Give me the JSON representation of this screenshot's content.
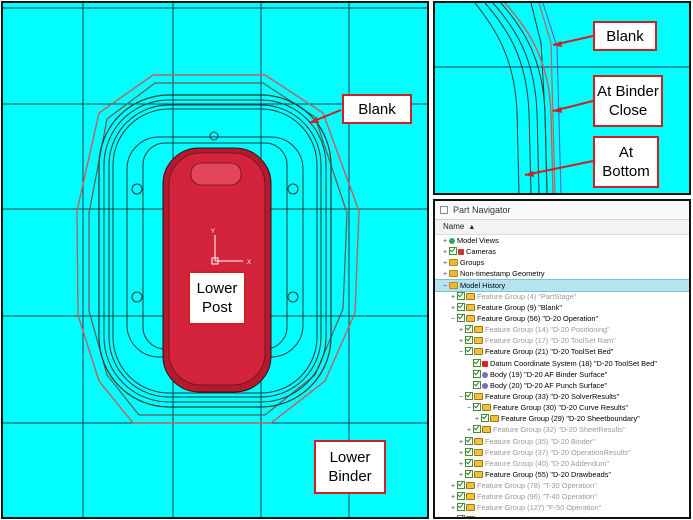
{
  "callouts": {
    "blank_main": "Blank",
    "lower_post": "Lower Post",
    "lower_binder": "Lower Binder",
    "blank_detail": "Blank",
    "at_binder_close": "At Binder Close",
    "at_bottom": "At Bottom"
  },
  "axis": {
    "y": "Y",
    "x": "X"
  },
  "colors": {
    "background": "#00ffff",
    "post": "#d4243c",
    "callout_border": "#cc2222",
    "blank_line": "#c06060"
  },
  "navigator": {
    "title": "Part Navigator",
    "column_name": "Name",
    "rows": [
      {
        "label": "Model Views",
        "icon": "views-icon",
        "indent": 0,
        "exp": "+",
        "gray": false,
        "selected": false,
        "check": false
      },
      {
        "label": "Cameras",
        "icon": "camera-icon",
        "indent": 0,
        "exp": "+",
        "gray": false,
        "selected": false,
        "check": true
      },
      {
        "label": "Groups",
        "icon": "folder-icon",
        "indent": 0,
        "exp": "+",
        "gray": false,
        "selected": false,
        "check": false
      },
      {
        "label": "Non-timestamp Geometry",
        "icon": "folder-icon",
        "indent": 0,
        "exp": "+",
        "gray": false,
        "selected": false,
        "check": false
      },
      {
        "label": "Model History",
        "icon": "folder-icon",
        "indent": 0,
        "exp": "−",
        "gray": false,
        "selected": true,
        "check": false
      },
      {
        "label": "Feature Group (4) \"PartStage\"",
        "icon": "feature-group-icon",
        "indent": 1,
        "exp": "+",
        "gray": true,
        "selected": false,
        "check": true
      },
      {
        "label": "Feature Group (9) \"Blank\"",
        "icon": "feature-group-icon",
        "indent": 1,
        "exp": "+",
        "gray": false,
        "selected": false,
        "check": true
      },
      {
        "label": "Feature Group (56) \"D-20 Operation\"",
        "icon": "feature-group-icon",
        "indent": 1,
        "exp": "−",
        "gray": false,
        "selected": false,
        "check": true
      },
      {
        "label": "Feature Group (14) \"D-20 Positioning\"",
        "icon": "feature-group-icon",
        "indent": 2,
        "exp": "+",
        "gray": true,
        "selected": false,
        "check": true
      },
      {
        "label": "Feature Group (17) \"D-20 ToolSet Ram\"",
        "icon": "feature-group-icon",
        "indent": 2,
        "exp": "+",
        "gray": true,
        "selected": false,
        "check": true
      },
      {
        "label": "Feature Group (21) \"D-20 ToolSet Bed\"",
        "icon": "feature-group-icon",
        "indent": 2,
        "exp": "−",
        "gray": false,
        "selected": false,
        "check": true
      },
      {
        "label": "Datum Coordinate System (18) \"D-20 ToolSet Bed\"",
        "icon": "csys-icon",
        "indent": 3,
        "exp": "",
        "gray": false,
        "selected": false,
        "check": true
      },
      {
        "label": "Body (19) \"D-20 AF Binder Surface\"",
        "icon": "body-icon",
        "indent": 3,
        "exp": "",
        "gray": false,
        "selected": false,
        "check": true
      },
      {
        "label": "Body (20) \"D-20 AF Punch Surface\"",
        "icon": "body-icon",
        "indent": 3,
        "exp": "",
        "gray": false,
        "selected": false,
        "check": true
      },
      {
        "label": "Feature Group (33) \"D-20 SolverResults\"",
        "icon": "feature-group-icon",
        "indent": 2,
        "exp": "−",
        "gray": false,
        "selected": false,
        "check": true
      },
      {
        "label": "Feature Group (30) \"D-20 Curve Results\"",
        "icon": "feature-group-icon",
        "indent": 3,
        "exp": "−",
        "gray": false,
        "selected": false,
        "check": true
      },
      {
        "label": "Feature Group (29) \"D-20 Sheetboundary\"",
        "icon": "feature-group-icon",
        "indent": 4,
        "exp": "+",
        "gray": false,
        "selected": false,
        "check": true
      },
      {
        "label": "Feature Group (32) \"D-20 SheetResults\"",
        "icon": "feature-group-icon",
        "indent": 3,
        "exp": "+",
        "gray": true,
        "selected": false,
        "check": true
      },
      {
        "label": "Feature Group (35) \"D-20 Binder\"",
        "icon": "feature-group-icon",
        "indent": 2,
        "exp": "+",
        "gray": true,
        "selected": false,
        "check": true
      },
      {
        "label": "Feature Group (37) \"D-20 OperationResults\"",
        "icon": "feature-group-icon",
        "indent": 2,
        "exp": "+",
        "gray": true,
        "selected": false,
        "check": true
      },
      {
        "label": "Feature Group (40) \"D-20 Addendum\"",
        "icon": "feature-group-icon",
        "indent": 2,
        "exp": "+",
        "gray": true,
        "selected": false,
        "check": true
      },
      {
        "label": "Feature Group (55) \"D-20 Drawbeads\"",
        "icon": "feature-group-icon",
        "indent": 2,
        "exp": "+",
        "gray": false,
        "selected": false,
        "check": true
      },
      {
        "label": "Feature Group (78) \"T-30 Operation\"",
        "icon": "feature-group-icon",
        "indent": 1,
        "exp": "+",
        "gray": true,
        "selected": false,
        "check": true
      },
      {
        "label": "Feature Group (96) \"T-40 Operation\"",
        "icon": "feature-group-icon",
        "indent": 1,
        "exp": "+",
        "gray": true,
        "selected": false,
        "check": true
      },
      {
        "label": "Feature Group (127) \"F-50 Operation\"",
        "icon": "feature-group-icon",
        "indent": 1,
        "exp": "+",
        "gray": true,
        "selected": false,
        "check": true
      },
      {
        "label": "Feature Group (141) \"M-60 Operation\"",
        "icon": "feature-group-icon",
        "indent": 1,
        "exp": "+",
        "gray": true,
        "selected": false,
        "check": true
      }
    ]
  }
}
